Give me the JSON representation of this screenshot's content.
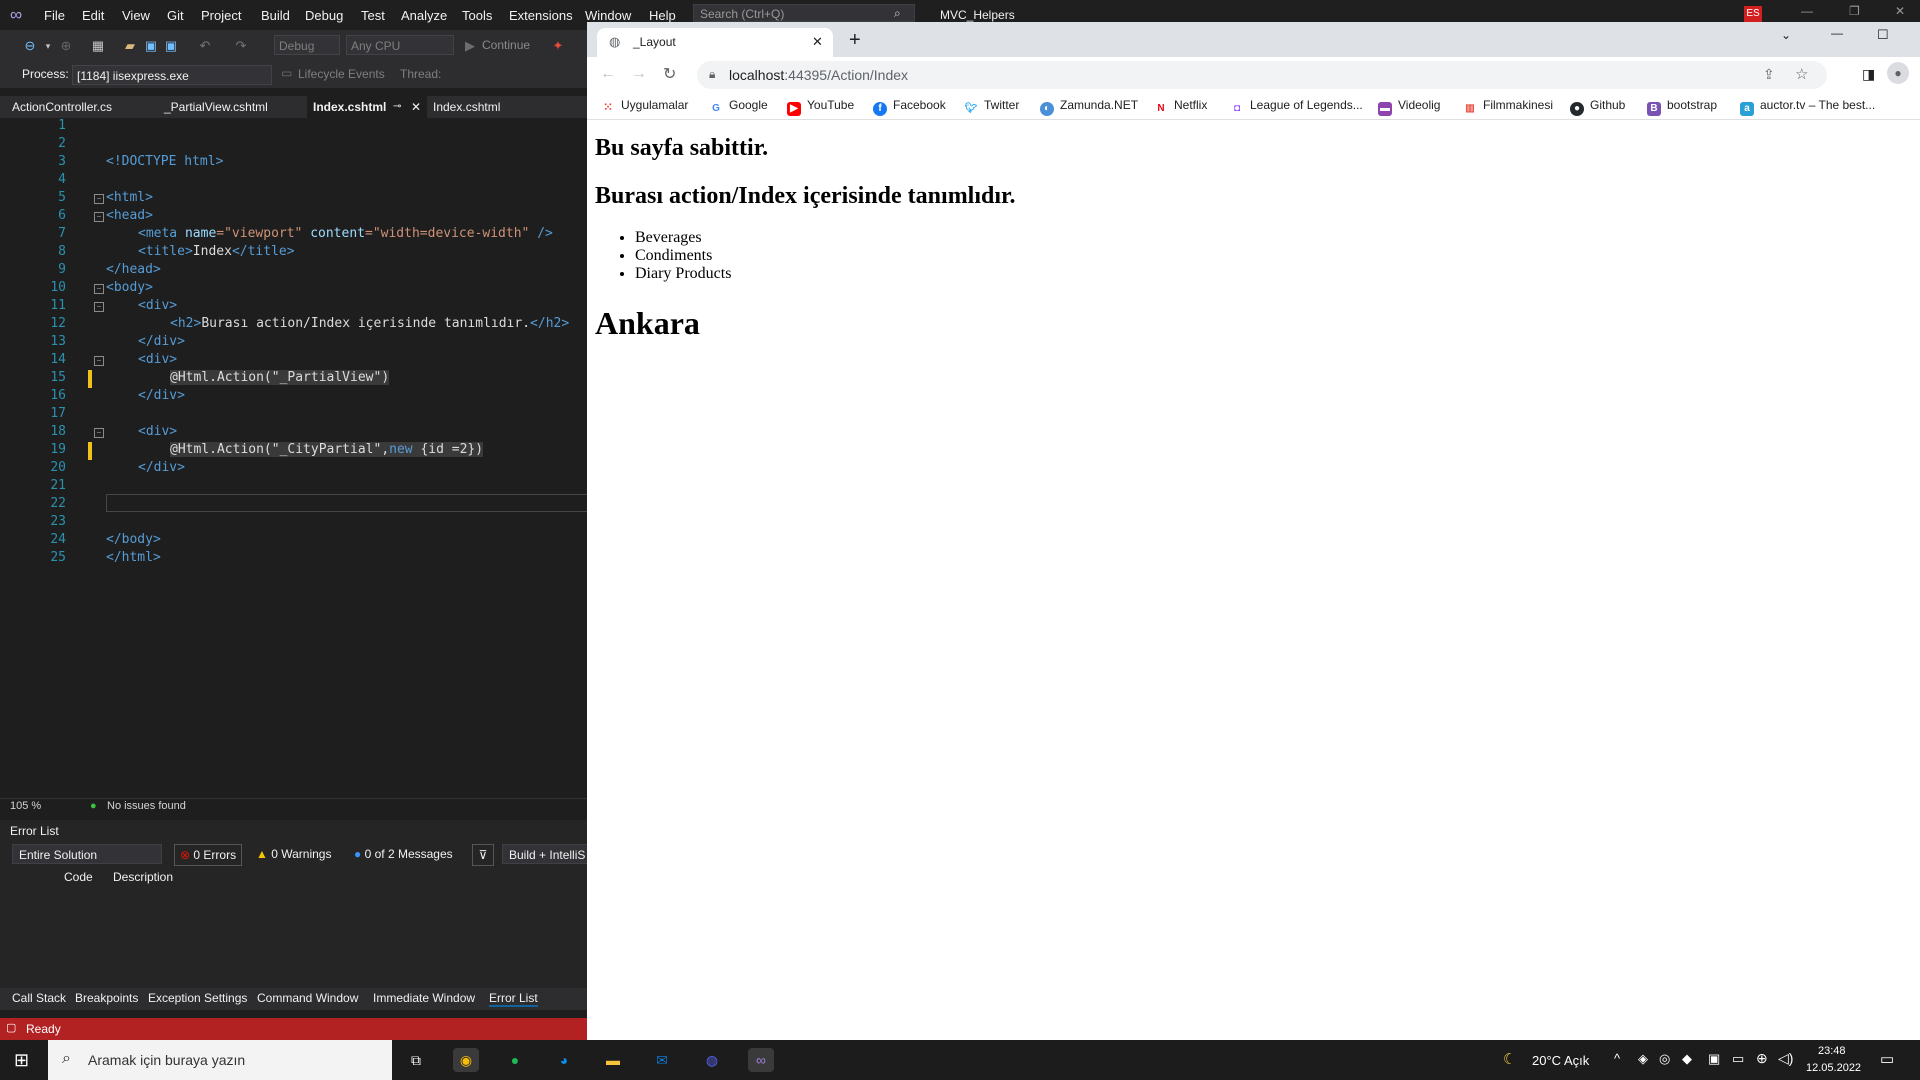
{
  "vs": {
    "menu": [
      "File",
      "Edit",
      "View",
      "Git",
      "Project",
      "Build",
      "Debug",
      "Test",
      "Analyze",
      "Tools",
      "Extensions",
      "Window",
      "Help"
    ],
    "search_placeholder": "Search (Ctrl+Q)",
    "solution_name": "MVC_Helpers",
    "user_initials": "ES",
    "toolbar": {
      "config": "Debug",
      "platform": "Any CPU",
      "continue": "Continue"
    },
    "procbar": {
      "process_label": "Process:",
      "process_value": "[1184] iisexpress.exe",
      "lifecycle": "Lifecycle Events",
      "thread_label": "Thread:"
    },
    "tabs": [
      "ActionController.cs",
      "_PartialView.cshtml",
      "Index.cshtml",
      "Index.cshtml"
    ],
    "code_lines": [
      "1",
      "2",
      "3",
      "4",
      "5",
      "6",
      "7",
      "8",
      "9",
      "10",
      "11",
      "12",
      "13",
      "14",
      "15",
      "16",
      "17",
      "18",
      "19",
      "20",
      "21",
      "22",
      "23",
      "24",
      "25"
    ],
    "code": {
      "doctype": "<!DOCTYPE html>",
      "l5": "<html>",
      "l6": "<head>",
      "l7_tag": "<meta",
      "l7_attr1": " name",
      "l7_v1": "=\"viewport\"",
      "l7_attr2": " content",
      "l7_v2": "=\"width=device-width\"",
      "l7_end": " />",
      "l8_open": "<title>",
      "l8_text": "Index",
      "l8_close": "</title>",
      "l9": "</head>",
      "l10": "<body>",
      "l11": "<div>",
      "l12_open": "<h2>",
      "l12_text": "Burası action/Index içerisinde tanımlıdır.",
      "l12_close": "</h2>",
      "l13": "</div>",
      "l14": "<div>",
      "l15": "@Html.Action(\"_PartialView\")",
      "l16": "</div>",
      "l18": "<div>",
      "l19a": "@Html.Action(\"_CityPartial\",",
      "l19b": "new",
      "l19c": " {id =2})",
      "l20": "</div>",
      "l23": "</body>",
      "l24": "</html>"
    },
    "zoom": "105 %",
    "issues": "No issues found",
    "errorlist": {
      "title": "Error List",
      "scope": "Entire Solution",
      "errors": "0 Errors",
      "warnings": "0 Warnings",
      "messages": "0 of 2 Messages",
      "build": "Build + IntelliS",
      "col_code": "Code",
      "col_desc": "Description"
    },
    "bottom_tabs": [
      "Call Stack",
      "Breakpoints",
      "Exception Settings",
      "Command Window",
      "Immediate Window",
      "Error List"
    ],
    "status": "Ready"
  },
  "chrome": {
    "tab_title": "_Layout",
    "url_host": "localhost",
    "url_rest": ":44395/Action/Index",
    "bookmarks": [
      "Uygulamalar",
      "Google",
      "YouTube",
      "Facebook",
      "Twitter",
      "Zamunda.NET",
      "Netflix",
      "League of Legends...",
      "Videolig",
      "Filmmakinesi",
      "Github",
      "bootstrap",
      "auctor.tv – The best..."
    ]
  },
  "page": {
    "h1": "Bu sayfa sabittir.",
    "h2": "Burası action/Index içerisinde tanımlıdır.",
    "items": [
      "Beverages",
      "Condiments",
      "Diary Products"
    ],
    "city": "Ankara"
  },
  "taskbar": {
    "search_placeholder": "Aramak için buraya yazın",
    "weather": "20°C  Açık",
    "time": "23:48",
    "date": "12.05.2022"
  }
}
